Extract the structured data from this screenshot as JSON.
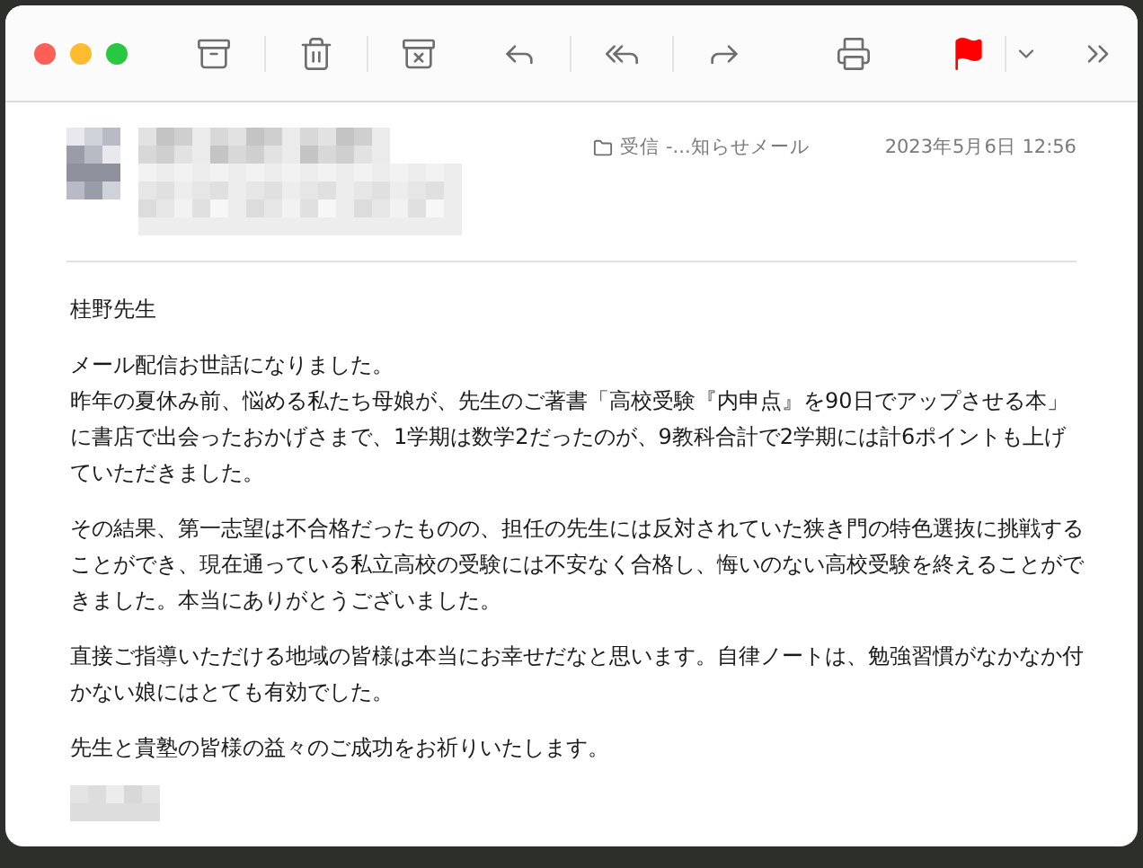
{
  "toolbar": {
    "flagged": true
  },
  "header": {
    "mailbox": "受信 -...知らせメール",
    "date": "2023年5月6日 12:56"
  },
  "body": {
    "greeting": "桂野先生",
    "paragraphs": [
      [
        "メール配信お世話になりました。",
        "昨年の夏休み前、悩める私たち母娘が、先生のご著書「高校受験『内申点』を90日でアップさせる本」に書店で出会ったおかげさまで、1学期は数学2だったのが、9教科合計で2学期には計6ポイントも上げていただきました。"
      ],
      [
        "その結果、第一志望は不合格だったものの、担任の先生には反対されていた狭き門の特色選抜に挑戦することができ、現在通っている私立高校の受験には不安なく合格し、悔いのない高校受験を終えることができました。本当にありがとうございました。"
      ],
      [
        "直接ご指導いただける地域の皆様は本当にお幸せだなと思います。自律ノートは、勉強習慣がなかなか付かない娘にはとても有効でした。"
      ],
      [
        "先生と貴塾の皆様の益々のご成功をお祈りいたします。"
      ]
    ]
  }
}
